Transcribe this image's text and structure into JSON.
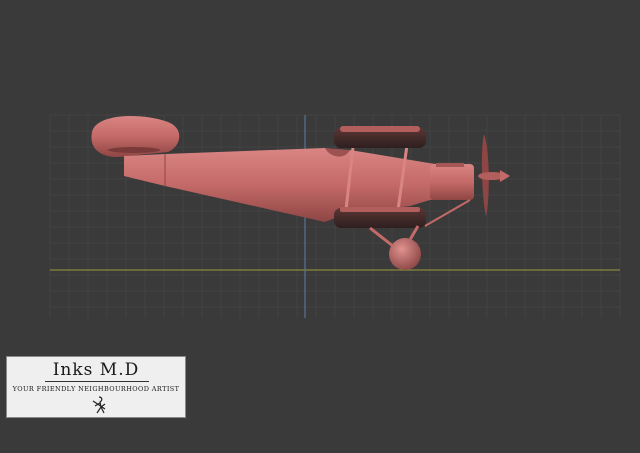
{
  "viewport": {
    "background": "#3a3a3a",
    "grid_color": "#4a4a4a",
    "ground_line_color": "#9a9a3a",
    "axis_line_color": "#5a7fa0",
    "model_color": "#c46a68"
  },
  "watermark": {
    "title": "Inks M.D",
    "subtitle": "Your friendly neighbourhood artist",
    "signature_icon": "sketch-figure-icon"
  }
}
